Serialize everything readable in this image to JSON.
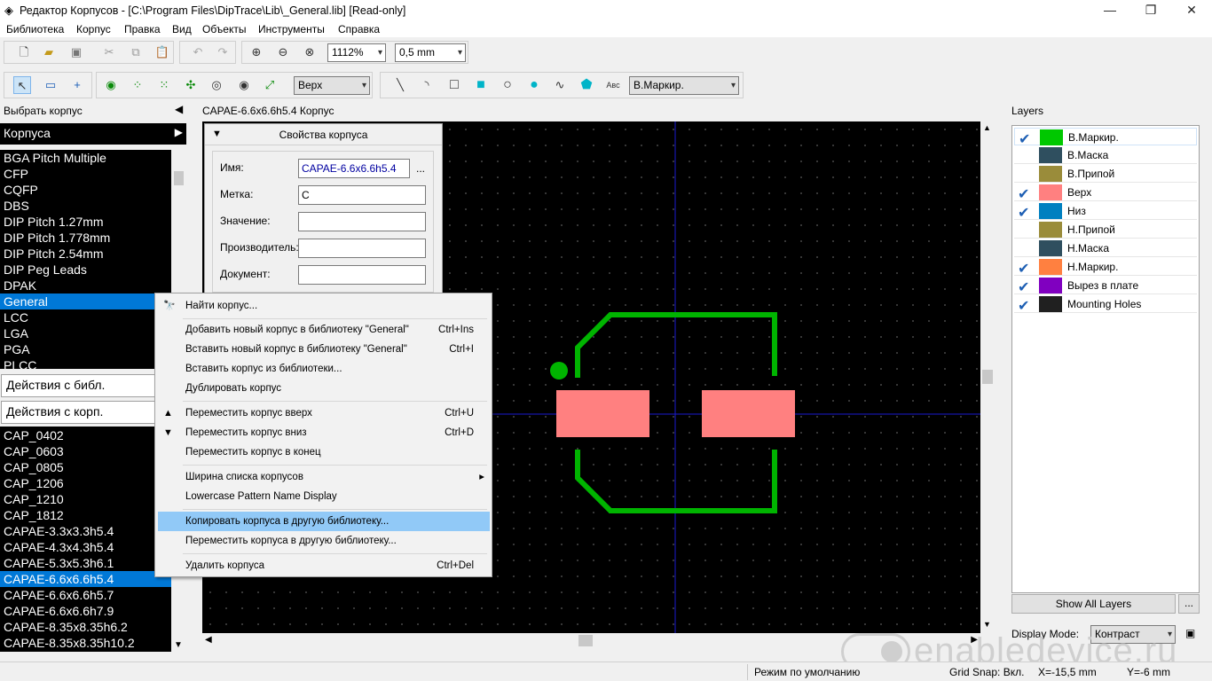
{
  "window": {
    "title": "Редактор Корпусов - [C:\\Program Files\\DipTrace\\Lib\\_General.lib] [Read-only]",
    "minimize": "—",
    "maximize": "❐",
    "close": "✕"
  },
  "menu": [
    "Библиотека",
    "Корпус",
    "Правка",
    "Вид",
    "Объекты",
    "Инструменты",
    "Справка"
  ],
  "toolbar1": {
    "zoom": "1112%",
    "grid": "0,5 mm"
  },
  "toolbar2": {
    "side": "Верх",
    "layer": "В.Маркир.",
    "text_tool": "Авс"
  },
  "left": {
    "header": "Выбрать корпус",
    "group_title": "Корпуса",
    "groups": [
      "BGA Pitch Multiple",
      "CFP",
      "CQFP",
      "DBS",
      "DIP Pitch 1.27mm",
      "DIP Pitch 1.778mm",
      "DIP Pitch 2.54mm",
      "DIP Peg Leads",
      "DPAK",
      "General",
      "LCC",
      "LGA",
      "PGA",
      "PLCC"
    ],
    "lib_actions": "Действия с библ.",
    "pat_actions": "Действия с корп.",
    "patterns": [
      "CAP_0402",
      "CAP_0603",
      "CAP_0805",
      "CAP_1206",
      "CAP_1210",
      "CAP_1812",
      "CAPAE-3.3x3.3h5.4",
      "CAPAE-4.3x4.3h5.4",
      "CAPAE-5.3x5.3h6.1",
      "CAPAE-6.6x6.6h5.4",
      "CAPAE-6.6x6.6h5.7",
      "CAPAE-6.6x6.6h7.9",
      "CAPAE-8.35x8.35h6.2",
      "CAPAE-8.35x8.35h10.2"
    ]
  },
  "center": {
    "tab_title": "CAPAE-6.6x6.6h5.4 Корпус"
  },
  "props": {
    "title": "Свойства корпуса",
    "name_label": "Имя:",
    "name_value": "CAPAE-6.6x6.6h5.4",
    "browse": "...",
    "tag_label": "Метка:",
    "tag_value": "C",
    "value_label": "Значение:",
    "value_value": "",
    "maker_label": "Производитель:",
    "maker_value": "",
    "doc_label": "Документ:",
    "doc_value": ""
  },
  "context_menu": {
    "find": "Найти корпус...",
    "add_new": "Добавить новый корпус в библиотеку \"General\"",
    "add_new_sc": "Ctrl+Ins",
    "insert_new": "Вставить новый корпус в библиотеку \"General\"",
    "insert_new_sc": "Ctrl+I",
    "insert_from_lib": "Вставить корпус из библиотеки...",
    "duplicate": "Дублировать корпус",
    "move_up": "Переместить корпус вверх",
    "move_up_sc": "Ctrl+U",
    "move_down": "Переместить корпус вниз",
    "move_down_sc": "Ctrl+D",
    "move_end": "Переместить корпус в конец",
    "list_width": "Ширина списка корпусов",
    "lowercase": "Lowercase Pattern Name Display",
    "copy_to_lib": "Копировать корпуса в другую библиотеку...",
    "move_to_lib": "Переместить корпуса в другую библиотеку...",
    "delete": "Удалить корпуса",
    "delete_sc": "Ctrl+Del"
  },
  "layers": {
    "title": "Layers",
    "items": [
      {
        "name": "В.Маркир.",
        "color": "#00c800",
        "checked": true
      },
      {
        "name": "В.Маска",
        "color": "#2f4f5f",
        "checked": false
      },
      {
        "name": "В.Припой",
        "color": "#9a8c3a",
        "checked": false
      },
      {
        "name": "Верх",
        "color": "#ff8080",
        "checked": true
      },
      {
        "name": "Низ",
        "color": "#0080c0",
        "checked": true
      },
      {
        "name": "Н.Припой",
        "color": "#9a8c3a",
        "checked": false
      },
      {
        "name": "Н.Маска",
        "color": "#2f4f5f",
        "checked": false
      },
      {
        "name": "Н.Маркир.",
        "color": "#ff8040",
        "checked": true
      },
      {
        "name": "Вырез в плате",
        "color": "#8000c0",
        "checked": true
      },
      {
        "name": "Mounting Holes",
        "color": "#202020",
        "checked": true
      }
    ],
    "show_all": "Show All Layers",
    "more": "...",
    "display_mode_label": "Display Mode:",
    "display_mode": "Контраст"
  },
  "status": {
    "mode": "Режим по умолчанию",
    "grid_snap": "Grid Snap: Вкл.",
    "x": "X=-15,5 mm",
    "y": "Y=-6 mm"
  },
  "watermark": "enabledevice.ru"
}
